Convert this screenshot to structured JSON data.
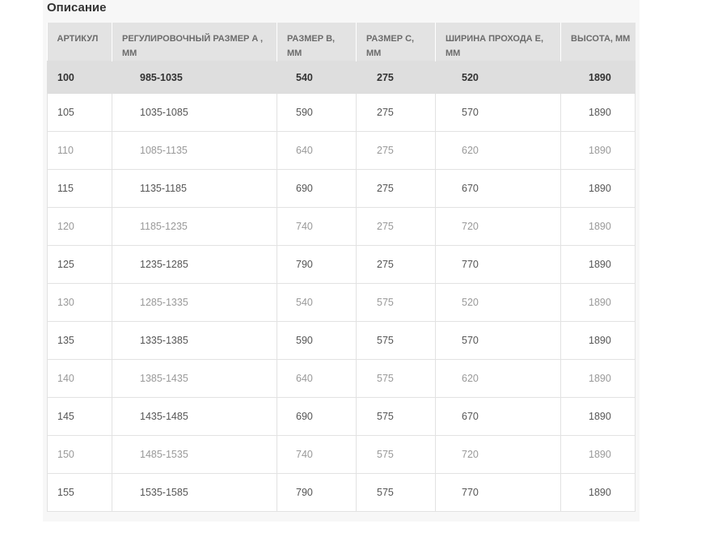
{
  "section_title": "Описание",
  "table": {
    "headers": [
      "АРТИКУЛ",
      "РЕГУЛИРОВОЧНЫЙ РАЗМЕР A , ММ",
      "РАЗМЕР B, ММ",
      "РАЗМЕР C, ММ",
      "ШИРИНА ПРОХОДА E, ММ",
      "ВЫСОТА, ММ"
    ],
    "rows": [
      [
        "100",
        "985-1035",
        "540",
        "275",
        "520",
        "1890"
      ],
      [
        "105",
        "1035-1085",
        "590",
        "275",
        "570",
        "1890"
      ],
      [
        "110",
        "1085-1135",
        "640",
        "275",
        "620",
        "1890"
      ],
      [
        "115",
        "1135-1185",
        "690",
        "275",
        "670",
        "1890"
      ],
      [
        "120",
        "1185-1235",
        "740",
        "275",
        "720",
        "1890"
      ],
      [
        "125",
        "1235-1285",
        "790",
        "275",
        "770",
        "1890"
      ],
      [
        "130",
        "1285-1335",
        "540",
        "575",
        "520",
        "1890"
      ],
      [
        "135",
        "1335-1385",
        "590",
        "575",
        "570",
        "1890"
      ],
      [
        "140",
        "1385-1435",
        "640",
        "575",
        "620",
        "1890"
      ],
      [
        "145",
        "1435-1485",
        "690",
        "575",
        "670",
        "1890"
      ],
      [
        "150",
        "1485-1535",
        "740",
        "575",
        "720",
        "1890"
      ],
      [
        "155",
        "1535-1585",
        "790",
        "575",
        "770",
        "1890"
      ]
    ]
  }
}
